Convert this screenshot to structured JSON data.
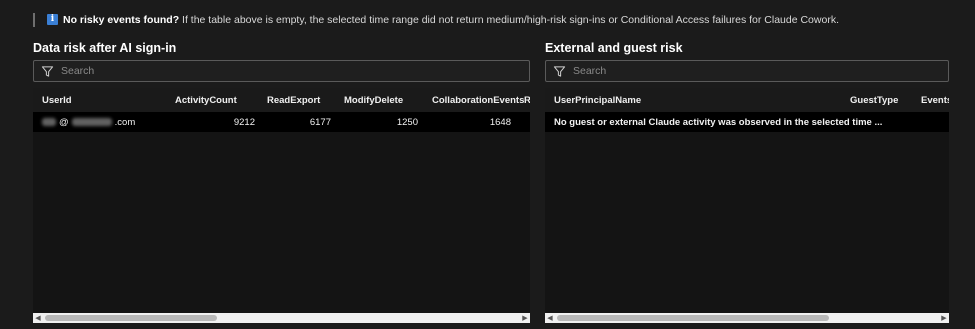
{
  "banner": {
    "icon": "info-icon",
    "bold_text": "No risky events found?",
    "text": " If the table above is empty, the selected time range did not return medium/high-risk sign-ins or Conditional Access failures for Claude Cowork."
  },
  "left_panel": {
    "title": "Data risk after AI sign-in",
    "search_placeholder": "Search",
    "columns": [
      "UserId",
      "ActivityCount",
      "ReadExport",
      "ModifyDelete",
      "CollaborationEvents",
      "R"
    ],
    "rows": [
      {
        "user_at": "@",
        "user_domain_suffix": ".com",
        "activity_count": "9212",
        "read_export": "6177",
        "modify_delete": "1250",
        "collaboration_events": "1648"
      }
    ]
  },
  "right_panel": {
    "title": "External and guest risk",
    "search_placeholder": "Search",
    "columns": [
      "UserPrincipalName",
      "GuestType",
      "Events"
    ],
    "message": "No guest or external Claude activity was observed in the selected time ..."
  },
  "colors": {
    "background": "#1b1b1b",
    "grid_background": "#141414",
    "accent_info": "#3a7fd5",
    "scrollbar": "#f0f0f0"
  }
}
